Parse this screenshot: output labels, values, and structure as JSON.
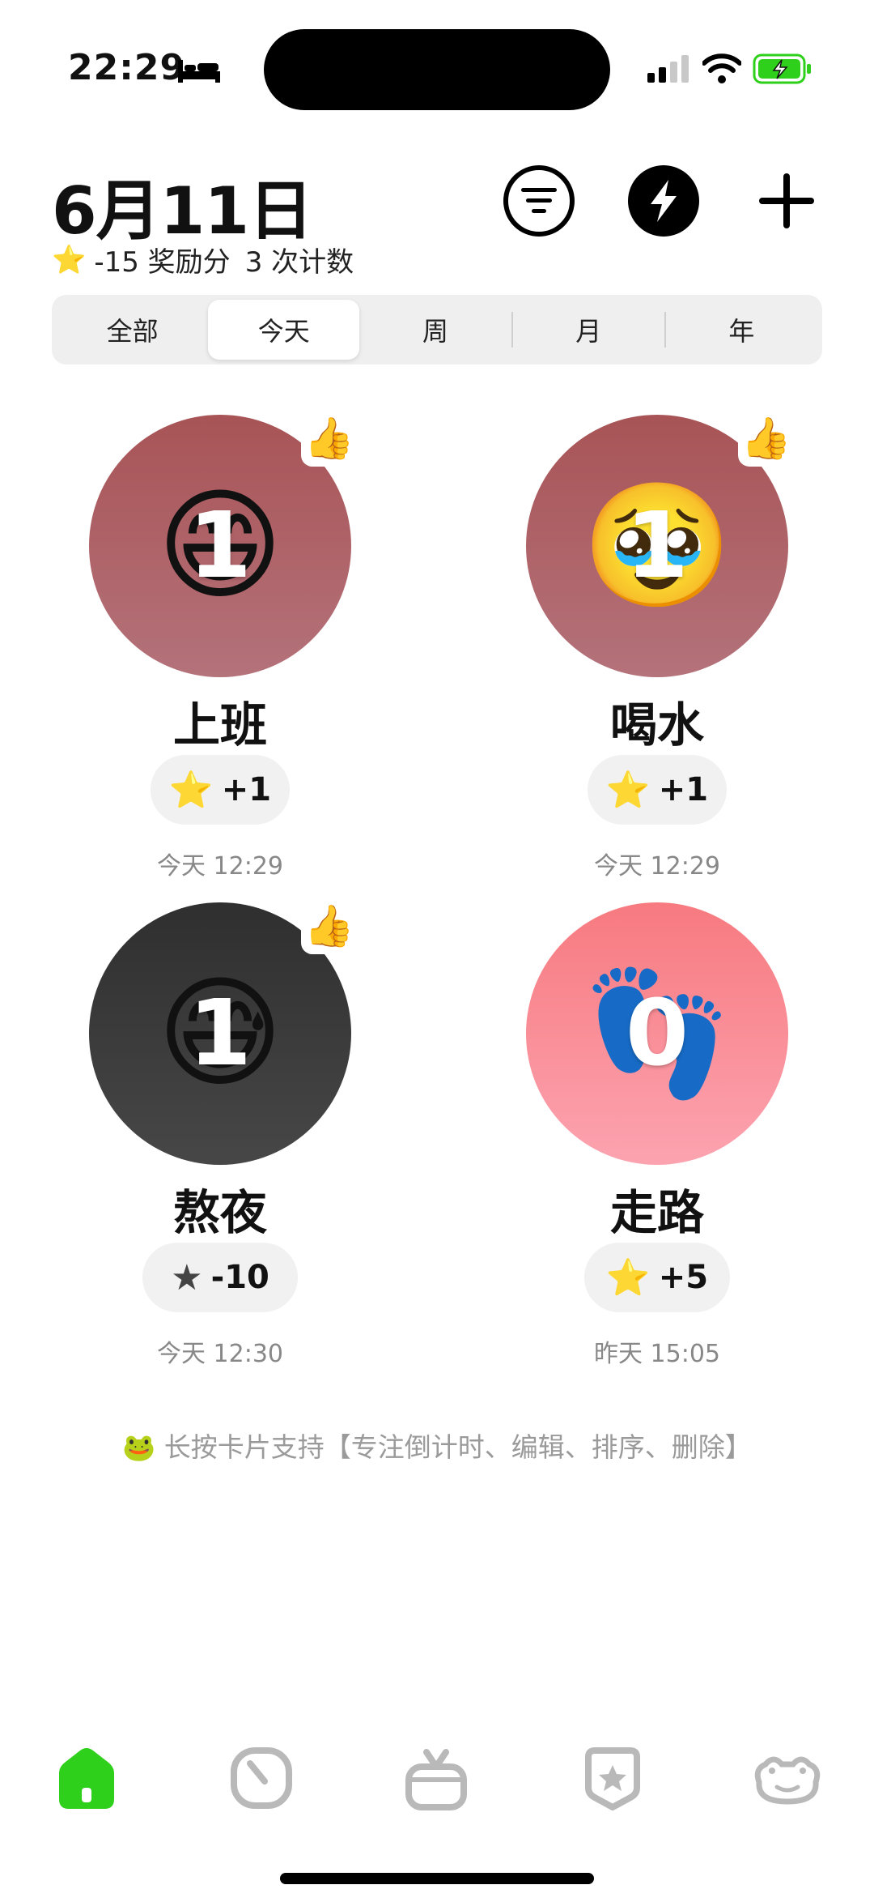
{
  "status_bar": {
    "time": "22:29"
  },
  "header": {
    "title": "6月11日",
    "summary_points": "-15 奖励分",
    "summary_count": "3 次计数"
  },
  "segments": [
    {
      "label": "全部",
      "active": false
    },
    {
      "label": "今天",
      "active": true
    },
    {
      "label": "周",
      "active": false
    },
    {
      "label": "月",
      "active": false
    },
    {
      "label": "年",
      "active": false
    }
  ],
  "cards": [
    {
      "title": "上班",
      "emoji": "😄",
      "count": "1",
      "points": "+1",
      "time": "今天 12:29",
      "star": "⭐",
      "liked": true
    },
    {
      "title": "喝水",
      "emoji": "🥹",
      "count": "1",
      "points": "+1",
      "time": "今天 12:29",
      "star": "⭐",
      "liked": true
    },
    {
      "title": "熬夜",
      "emoji": "😅",
      "count": "1",
      "points": "-10",
      "time": "今天 12:30",
      "star": "★",
      "liked": true
    },
    {
      "title": "走路",
      "emoji": "👣",
      "count": "0",
      "points": "+5",
      "time": "昨天 15:05",
      "star": "⭐",
      "liked": false
    }
  ],
  "hint": "🐸 长按卡片支持【专注倒计时、编辑、排序、删除】",
  "tabbar": [
    "home-icon",
    "timer-icon",
    "gift-icon",
    "star-badge-icon",
    "frog-icon"
  ],
  "colors": {
    "card_red_top": "#a85456",
    "card_red_bottom": "#b4727a",
    "card_dark": "#3a3a3a",
    "card_pink_top": "#f77a80",
    "card_pink_bottom": "#fca3b0",
    "accent_green": "#2fd01b",
    "tab_gray": "#b9b9b9"
  }
}
